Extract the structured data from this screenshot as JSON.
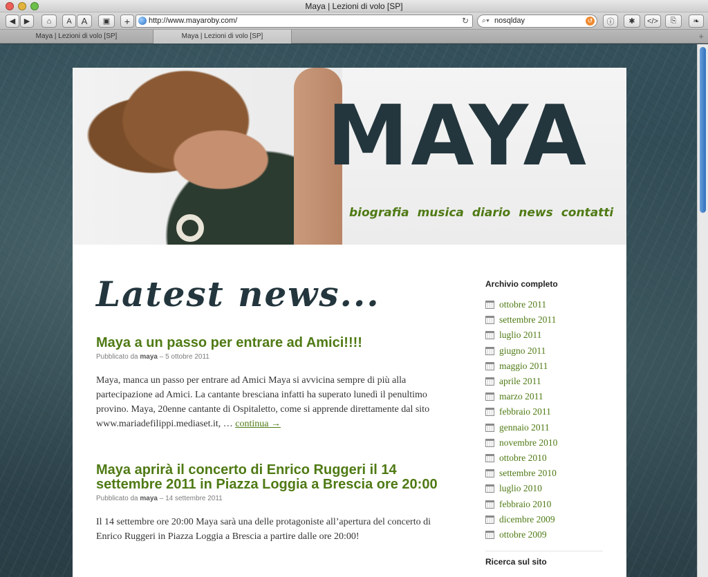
{
  "window": {
    "title": "Maya | Lezioni di volo [SP]"
  },
  "toolbar": {
    "url": "http://www.mayaroby.com/",
    "search_value": "nosqlday",
    "font_small": "A",
    "font_large": "A",
    "add_label": "+"
  },
  "tabs": [
    {
      "label": "Maya | Lezioni di volo [SP]",
      "active": false
    },
    {
      "label": "Maya | Lezioni di volo [SP]",
      "active": true
    }
  ],
  "header": {
    "logo": "MAYA",
    "nav": [
      "biografia",
      "musica",
      "diario",
      "news",
      "contatti"
    ]
  },
  "main": {
    "heading": "Latest news...",
    "posts": [
      {
        "title": "Maya a un passo per entrare ad Amici!!!!",
        "meta_prefix": "Pubblicato da",
        "author": "maya",
        "meta_sep": "–",
        "date": "5 ottobre 2011",
        "excerpt": "Maya, manca un passo per entrare ad Amici Maya si avvicina sempre di più alla partecipazione ad Amici. La cantante bresciana infatti ha superato lunedì il penultimo provino. Maya, 20enne cantante di Ospitaletto, come si apprende direttamente dal sito www.mariadefilippi.mediaset.it, …",
        "more": "continua →"
      },
      {
        "title": "Maya aprirà il concerto di Enrico Ruggeri il 14 settembre 2011 in Piazza Loggia a Brescia ore 20:00",
        "meta_prefix": "Pubblicato da",
        "author": "maya",
        "meta_sep": "–",
        "date": "14 settembre 2011",
        "excerpt": "Il 14 settembre ore 20:00 Maya sarà una delle protagoniste all’apertura del concerto di Enrico Ruggeri in Piazza Loggia a Brescia a partire dalle ore 20:00!",
        "more": ""
      }
    ]
  },
  "sidebar": {
    "archive_title": "Archivio completo",
    "archive": [
      "ottobre 2011",
      "settembre 2011",
      "luglio 2011",
      "giugno 2011",
      "maggio 2011",
      "aprile 2011",
      "marzo 2011",
      "febbraio 2011",
      "gennaio 2011",
      "novembre 2010",
      "ottobre 2010",
      "settembre 2010",
      "luglio 2010",
      "febbraio 2010",
      "dicembre 2009",
      "ottobre 2009"
    ],
    "search_title": "Ricerca sul sito"
  },
  "colors": {
    "accent_green": "#4f7a14",
    "logo_dark": "#24363d",
    "background": "#2b3f47"
  }
}
